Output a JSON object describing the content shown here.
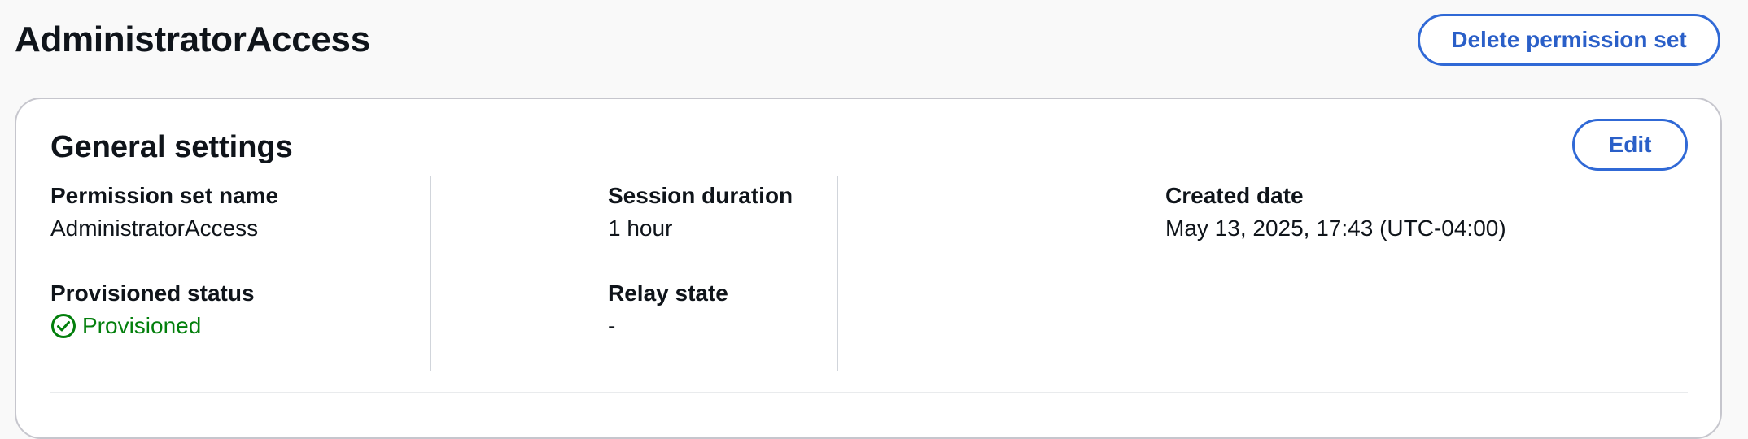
{
  "header": {
    "title": "AdministratorAccess",
    "delete_label": "Delete permission set"
  },
  "general_settings": {
    "title": "General settings",
    "edit_label": "Edit",
    "fields": {
      "permission_set_name": {
        "label": "Permission set name",
        "value": "AdministratorAccess"
      },
      "session_duration": {
        "label": "Session duration",
        "value": "1 hour"
      },
      "created_date": {
        "label": "Created date",
        "value": "May 13, 2025, 17:43 (UTC-04:00)"
      },
      "provisioned_status": {
        "label": "Provisioned status",
        "value": "Provisioned",
        "icon": "check-circle-icon",
        "color": "#037f0c"
      },
      "relay_state": {
        "label": "Relay state",
        "value": "-"
      }
    }
  },
  "colors": {
    "accent": "#3069d6",
    "success": "#037f0c",
    "text": "#0f141a",
    "background": "#f9f9f9"
  }
}
